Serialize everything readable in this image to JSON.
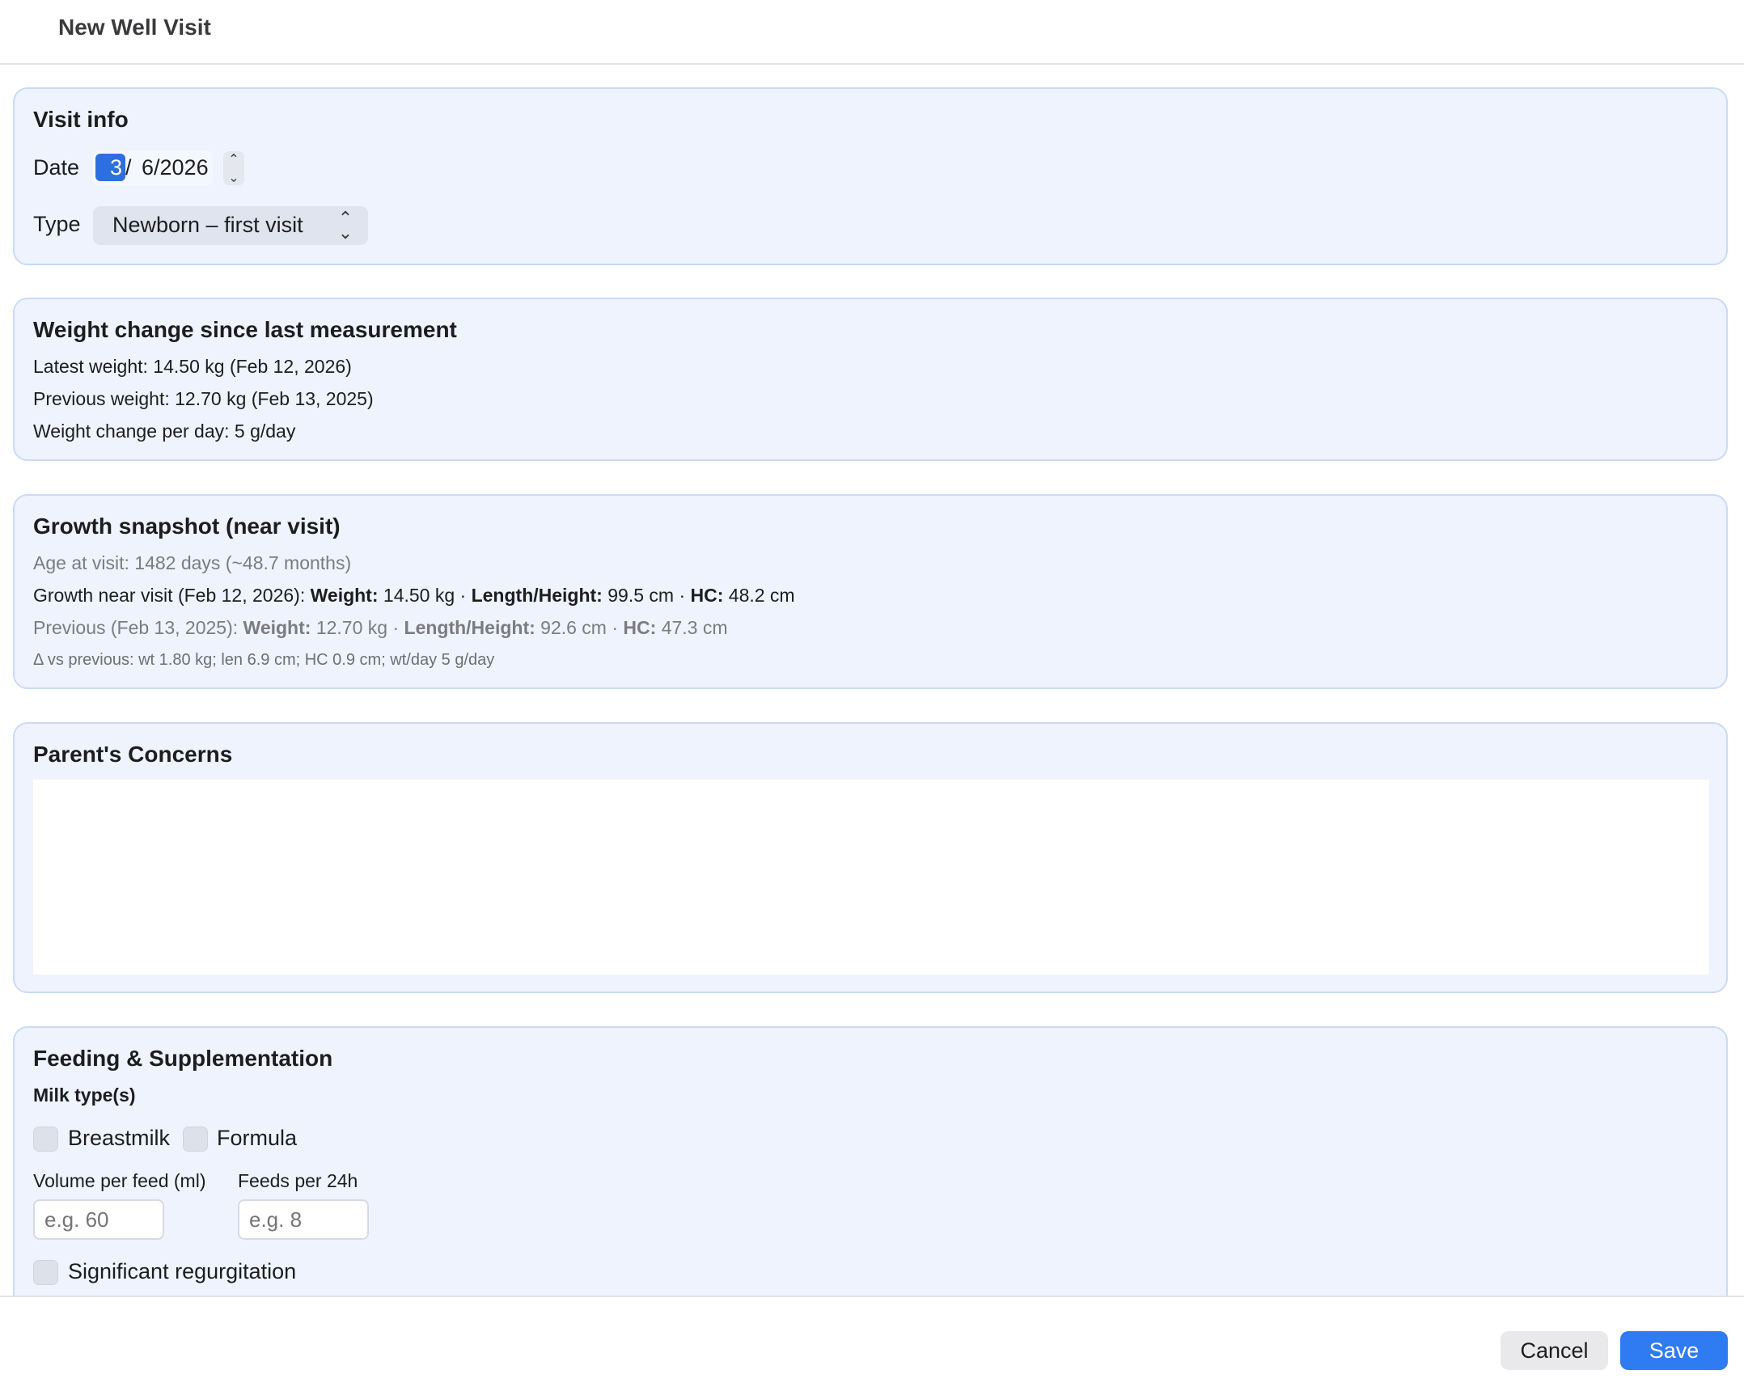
{
  "window": {
    "title": "New Well Visit"
  },
  "visit_info": {
    "heading": "Visit info",
    "date_label": "Date",
    "date_month": "3",
    "date_slash": "/",
    "date_rest": "6/2026",
    "type_label": "Type",
    "type_value": "Newborn – first visit"
  },
  "weight_change": {
    "heading": "Weight change since last measurement",
    "latest": "Latest weight: 14.50 kg (Feb 12, 2026)",
    "previous": "Previous weight: 12.70 kg (Feb 13, 2025)",
    "per_day": "Weight change per day: 5 g/day"
  },
  "growth": {
    "heading": "Growth snapshot (near visit)",
    "age": "Age at visit: 1482 days (~48.7 months)",
    "near_prefix": "Growth near visit (Feb 12, 2026): ",
    "weight_label": "Weight:",
    "near_weight": " 14.50 kg · ",
    "length_label": "Length/Height:",
    "near_length": " 99.5 cm · ",
    "hc_label": "HC:",
    "near_hc": " 48.2 cm",
    "prev_prefix": "Previous (Feb 13, 2025): ",
    "prev_weight": " 12.70 kg · ",
    "prev_length": " 92.6 cm · ",
    "prev_hc": " 47.3 cm",
    "delta": "Δ vs previous: wt 1.80 kg; len 6.9 cm; HC 0.9 cm; wt/day 5 g/day"
  },
  "concerns": {
    "heading": "Parent's Concerns",
    "value": ""
  },
  "feeding": {
    "heading": "Feeding & Supplementation",
    "milk_types_label": "Milk type(s)",
    "breastmilk_label": "Breastmilk",
    "breastmilk_checked": false,
    "formula_label": "Formula",
    "formula_checked": false,
    "volume_label": "Volume per feed (ml)",
    "volume_placeholder": "e.g. 60",
    "feeds_label": "Feeds per 24h",
    "feeds_placeholder": "e.g. 8",
    "regurgitation_label": "Significant regurgitation",
    "regurgitation_checked": false
  },
  "footer": {
    "cancel_label": "Cancel",
    "save_label": "Save"
  },
  "colors": {
    "card_bg": "#eef3fe",
    "card_border": "#c9dbf6",
    "accent": "#2f7bf2",
    "selected_segment": "#2d6fe0"
  }
}
